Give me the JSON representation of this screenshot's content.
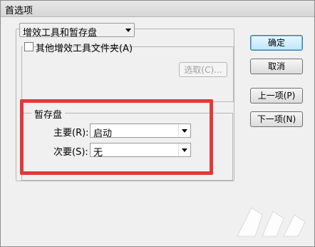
{
  "window": {
    "title": "首选项"
  },
  "section_dropdown": {
    "value": "增效工具和暂存盘"
  },
  "plugins": {
    "checkbox_label": "其他增效工具文件夹(A)",
    "choose_button": "选取(C)..."
  },
  "scratch": {
    "legend": "暂存盘",
    "primary_label": "主要(R):",
    "primary_value": "启动",
    "secondary_label": "次要(S):",
    "secondary_value": "无"
  },
  "buttons": {
    "ok": "确定",
    "cancel": "取消",
    "prev": "上一项(P)",
    "next": "下一项(N)"
  },
  "colors": {
    "highlight": "#e23a3a",
    "default_button_border": "#3c7fb1"
  }
}
